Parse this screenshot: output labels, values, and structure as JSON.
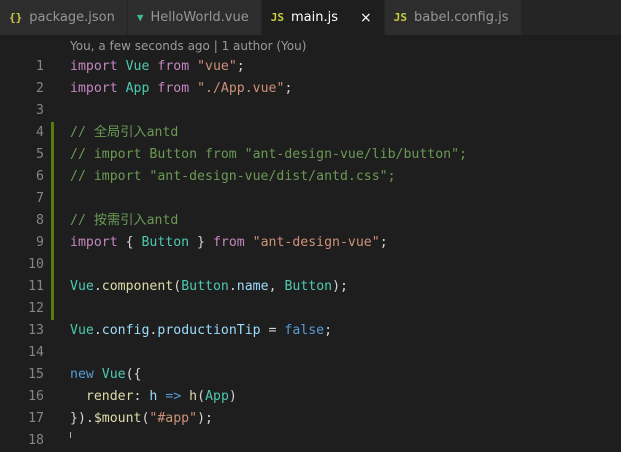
{
  "tabs": [
    {
      "icon_text": "{}",
      "icon": "json-braces-icon",
      "icon_color": "#cbcb41",
      "label": "package.json",
      "active": false
    },
    {
      "icon_text": "▼",
      "icon": "vue-icon",
      "icon_color": "#41b883",
      "label": "HelloWorld.vue",
      "active": false
    },
    {
      "icon_text": "JS",
      "icon": "js-icon",
      "icon_color": "#cbcb41",
      "label": "main.js",
      "active": true,
      "close": "×"
    },
    {
      "icon_text": "JS",
      "icon": "js-icon",
      "icon_color": "#cbcb41",
      "label": "babel.config.js",
      "active": false
    }
  ],
  "blame": "You, a few seconds ago | 1 author (You)",
  "lines": [
    {
      "n": "1",
      "mod": false,
      "tokens": [
        [
          "import",
          "import"
        ],
        [
          "plain",
          " "
        ],
        [
          "class",
          "Vue"
        ],
        [
          "plain",
          " "
        ],
        [
          "import",
          "from"
        ],
        [
          "plain",
          " "
        ],
        [
          "string",
          "\"vue\""
        ],
        [
          "plain",
          ";"
        ]
      ]
    },
    {
      "n": "2",
      "mod": false,
      "tokens": [
        [
          "import",
          "import"
        ],
        [
          "plain",
          " "
        ],
        [
          "class",
          "App"
        ],
        [
          "plain",
          " "
        ],
        [
          "import",
          "from"
        ],
        [
          "plain",
          " "
        ],
        [
          "string",
          "\"./App.vue\""
        ],
        [
          "plain",
          ";"
        ]
      ]
    },
    {
      "n": "3",
      "mod": false,
      "tokens": []
    },
    {
      "n": "4",
      "mod": true,
      "tokens": [
        [
          "comment",
          "// 全局引入antd"
        ]
      ]
    },
    {
      "n": "5",
      "mod": true,
      "tokens": [
        [
          "comment",
          "// import Button from \"ant-design-vue/lib/button\";"
        ]
      ]
    },
    {
      "n": "6",
      "mod": true,
      "tokens": [
        [
          "comment",
          "// import \"ant-design-vue/dist/antd.css\";"
        ]
      ]
    },
    {
      "n": "7",
      "mod": true,
      "tokens": []
    },
    {
      "n": "8",
      "mod": true,
      "tokens": [
        [
          "comment",
          "// 按需引入antd"
        ]
      ]
    },
    {
      "n": "9",
      "mod": true,
      "tokens": [
        [
          "import",
          "import"
        ],
        [
          "plain",
          " { "
        ],
        [
          "class",
          "Button"
        ],
        [
          "plain",
          " } "
        ],
        [
          "import",
          "from"
        ],
        [
          "plain",
          " "
        ],
        [
          "string",
          "\"ant-design-vue\""
        ],
        [
          "plain",
          ";"
        ]
      ]
    },
    {
      "n": "10",
      "mod": true,
      "tokens": []
    },
    {
      "n": "11",
      "mod": true,
      "tokens": [
        [
          "class",
          "Vue"
        ],
        [
          "plain",
          "."
        ],
        [
          "func",
          "component"
        ],
        [
          "plain",
          "("
        ],
        [
          "class",
          "Button"
        ],
        [
          "plain",
          "."
        ],
        [
          "var",
          "name"
        ],
        [
          "plain",
          ", "
        ],
        [
          "class",
          "Button"
        ],
        [
          "plain",
          ");"
        ]
      ]
    },
    {
      "n": "12",
      "mod": true,
      "tokens": []
    },
    {
      "n": "13",
      "mod": false,
      "tokens": [
        [
          "class",
          "Vue"
        ],
        [
          "plain",
          "."
        ],
        [
          "var",
          "config"
        ],
        [
          "plain",
          "."
        ],
        [
          "var",
          "productionTip"
        ],
        [
          "plain",
          " = "
        ],
        [
          "keyword",
          "false"
        ],
        [
          "plain",
          ";"
        ]
      ]
    },
    {
      "n": "14",
      "mod": false,
      "tokens": []
    },
    {
      "n": "15",
      "mod": false,
      "tokens": [
        [
          "keyword",
          "new"
        ],
        [
          "plain",
          " "
        ],
        [
          "class",
          "Vue"
        ],
        [
          "plain",
          "({"
        ]
      ]
    },
    {
      "n": "16",
      "mod": false,
      "tokens": [
        [
          "plain",
          "  "
        ],
        [
          "func",
          "render"
        ],
        [
          "plain",
          ": "
        ],
        [
          "var",
          "h"
        ],
        [
          "plain",
          " "
        ],
        [
          "keyword",
          "=>"
        ],
        [
          "plain",
          " "
        ],
        [
          "func",
          "h"
        ],
        [
          "plain",
          "("
        ],
        [
          "class",
          "App"
        ],
        [
          "plain",
          ")"
        ]
      ]
    },
    {
      "n": "17",
      "mod": false,
      "tokens": [
        [
          "plain",
          "})."
        ],
        [
          "func",
          "$mount"
        ],
        [
          "plain",
          "("
        ],
        [
          "string",
          "\"#app\""
        ],
        [
          "plain",
          ");"
        ]
      ]
    },
    {
      "n": "18",
      "mod": false,
      "tokens": []
    }
  ]
}
